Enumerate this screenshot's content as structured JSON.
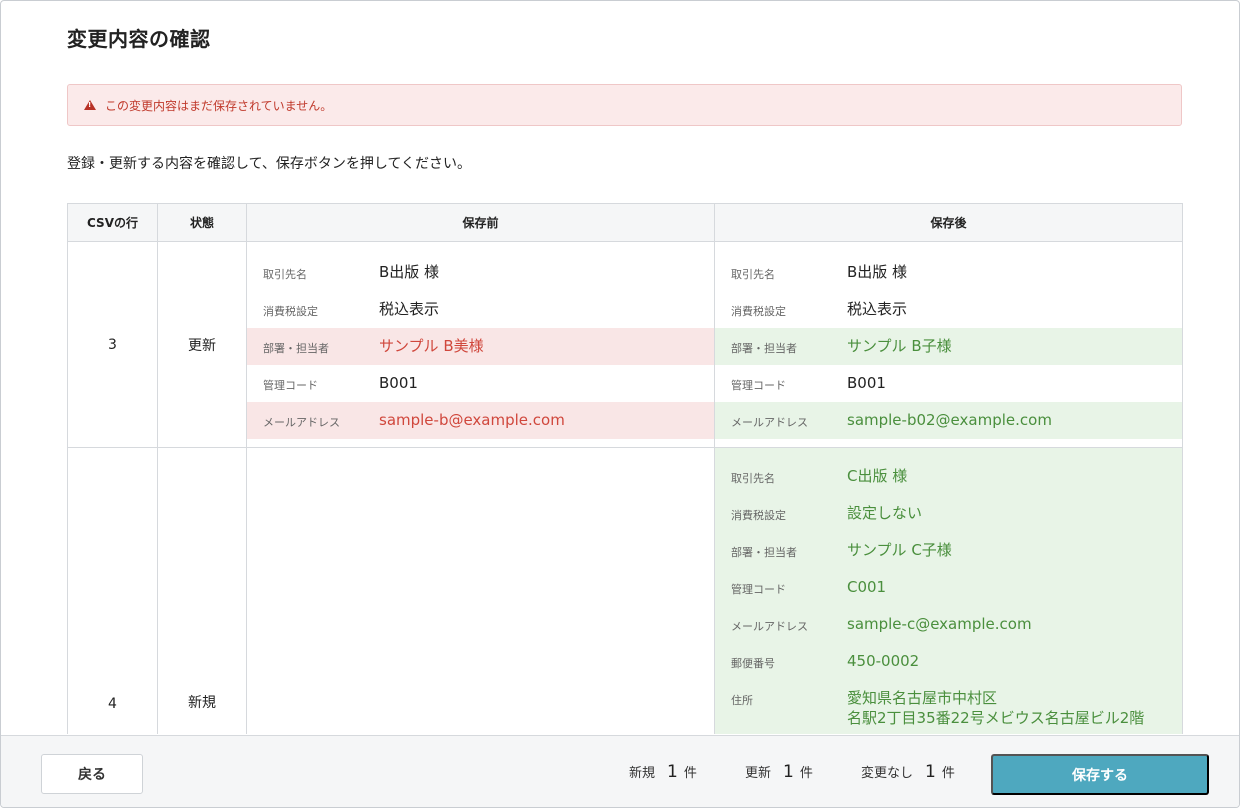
{
  "page": {
    "title": "変更内容の確認"
  },
  "alert": {
    "message": "この変更内容はまだ保存されていません。"
  },
  "instruction": "登録・更新する内容を確認して、保存ボタンを押してください。",
  "table": {
    "headers": [
      "CSVの行",
      "状態",
      "保存前",
      "保存後"
    ],
    "rows": [
      {
        "csv_row": "3",
        "status": "更新",
        "before": [
          {
            "label": "取引先名",
            "value": "B出版 様"
          },
          {
            "label": "消費税設定",
            "value": "税込表示"
          },
          {
            "label": "部署・担当者",
            "value": "サンプル B美様"
          },
          {
            "label": "管理コード",
            "value": "B001"
          },
          {
            "label": "メールアドレス",
            "value": "sample-b@example.com"
          }
        ],
        "after": [
          {
            "label": "取引先名",
            "value": "B出版 様"
          },
          {
            "label": "消費税設定",
            "value": "税込表示"
          },
          {
            "label": "部署・担当者",
            "value": "サンプル B子様"
          },
          {
            "label": "管理コード",
            "value": "B001"
          },
          {
            "label": "メールアドレス",
            "value": "sample-b02@example.com"
          }
        ]
      },
      {
        "csv_row": "4",
        "status": "新規",
        "after": [
          {
            "label": "取引先名",
            "value": "C出版 様"
          },
          {
            "label": "消費税設定",
            "value": "設定しない"
          },
          {
            "label": "部署・担当者",
            "value": "サンプル C子様"
          },
          {
            "label": "管理コード",
            "value": "C001"
          },
          {
            "label": "メールアドレス",
            "value": "sample-c@example.com"
          },
          {
            "label": "郵便番号",
            "value": "450-0002"
          },
          {
            "label": "住所",
            "value": "愛知県名古屋市中村区"
          },
          {
            "label": "",
            "value": "名駅2丁目35番22号メビウス名古屋ビル2階"
          }
        ]
      }
    ]
  },
  "footer": {
    "back_label": "戻る",
    "summary": [
      {
        "label": "新規",
        "count": "1",
        "unit": "件"
      },
      {
        "label": "更新",
        "count": "1",
        "unit": "件"
      },
      {
        "label": "変更なし",
        "count": "1",
        "unit": "件"
      }
    ],
    "save_label": "保存する"
  },
  "colors": {
    "accent": "#4ea8bf",
    "removed_bg": "#f9e6e6",
    "removed_text": "#d0473c",
    "added_bg": "#e8f4e7",
    "added_text": "#4a8f3d",
    "alert_bg": "#fbeaea",
    "alert_text": "#c0392b"
  }
}
